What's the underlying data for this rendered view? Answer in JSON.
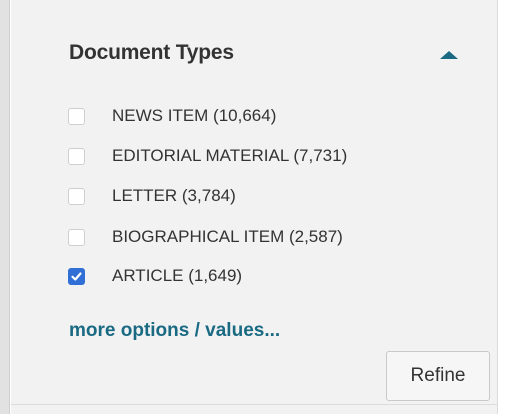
{
  "filter": {
    "title": "Document Types",
    "toggle_icon": "caret-up-icon",
    "accent_color": "#1a6a83",
    "checkbox_checked_color": "#2f6fd6",
    "options": [
      {
        "label": "NEWS ITEM (10,664)",
        "checked": false
      },
      {
        "label": "EDITORIAL MATERIAL (7,731)",
        "checked": false
      },
      {
        "label": "LETTER (3,784)",
        "checked": false
      },
      {
        "label": "BIOGRAPHICAL ITEM (2,587)",
        "checked": false
      },
      {
        "label": "ARTICLE (1,649)",
        "checked": true
      }
    ],
    "more_link": "more options / values...",
    "refine_label": "Refine"
  }
}
